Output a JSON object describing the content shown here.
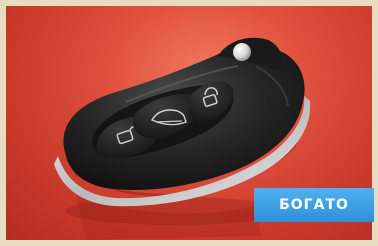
{
  "photo": {
    "subject_icon": "car-key-fob-icon",
    "button_icons": [
      "unlock-icon",
      "trunk-icon",
      "lock-icon"
    ]
  },
  "badge": {
    "label": "БОГАТО",
    "color": "#3a9be3"
  },
  "colors": {
    "frame": "#e6dcc0",
    "background": "#d9473a",
    "fob_body": "#1e1e1e"
  }
}
